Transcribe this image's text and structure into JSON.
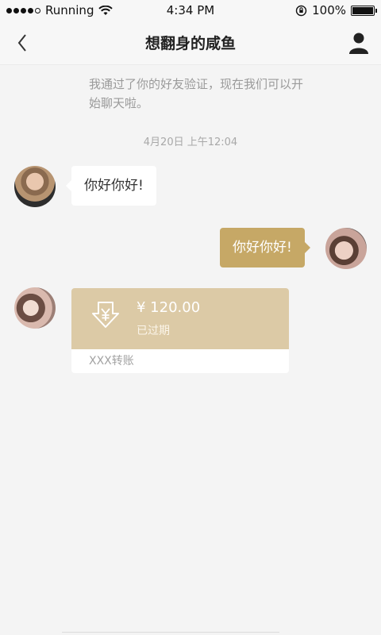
{
  "status_bar": {
    "carrier": "Running",
    "time": "4:34 PM",
    "battery": "100%",
    "battery_level": 1.0
  },
  "header": {
    "title": "想翻身的咸鱼"
  },
  "chat": {
    "system_notice": "我通过了你的好友验证，现在我们可以开始聊天啦。",
    "timestamp": "4月20日 上午12:04",
    "messages": [
      {
        "side": "incoming",
        "text": "你好你好!"
      },
      {
        "side": "outgoing",
        "text": "你好你好!"
      }
    ],
    "transfer": {
      "amount": "¥ 120.00",
      "status": "已过期",
      "note": "XXX转账",
      "icon": "transfer-yen-icon"
    }
  },
  "colors": {
    "accent": "#c6a866",
    "transfer_card": "#dccaa6",
    "background": "#f4f4f4"
  }
}
